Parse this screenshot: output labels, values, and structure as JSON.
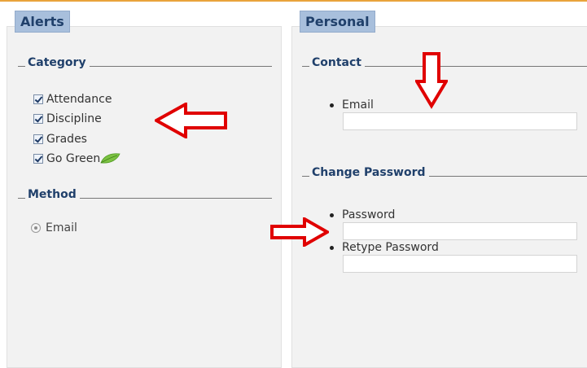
{
  "colors": {
    "accent_line": "#e9a33c",
    "tab_bg": "#a8bfdc",
    "tab_text": "#20406b",
    "arrow": "#e00000"
  },
  "alerts": {
    "tab_label": "Alerts",
    "category": {
      "title": "Category",
      "items": [
        {
          "label": "Attendance",
          "checked": true
        },
        {
          "label": "Discipline",
          "checked": true
        },
        {
          "label": "Grades",
          "checked": true
        },
        {
          "label": "Go Green",
          "checked": true,
          "icon": "leaf-icon"
        }
      ]
    },
    "method": {
      "title": "Method",
      "option": {
        "label": "Email",
        "selected": true
      }
    }
  },
  "personal": {
    "tab_label": "Personal",
    "contact": {
      "title": "Contact",
      "email_label": "Email",
      "email_value": ""
    },
    "change_password": {
      "title": "Change Password",
      "password_label": "Password",
      "password_value": "",
      "retype_label": "Retype Password",
      "retype_value": ""
    }
  },
  "annotations": [
    "arrow-left-icon",
    "arrow-down-icon",
    "arrow-right-icon"
  ]
}
